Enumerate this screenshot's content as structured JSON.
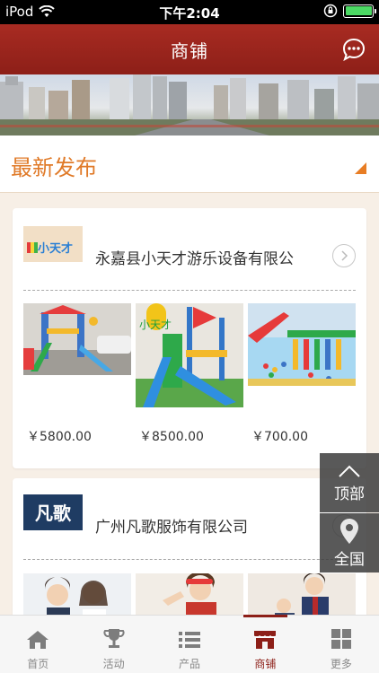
{
  "status": {
    "carrier": "iPod",
    "time": "下午2:04"
  },
  "nav": {
    "title": "商铺"
  },
  "section": {
    "title": "最新发布"
  },
  "stores": [
    {
      "name": "永嘉县小天才游乐设备有限公",
      "logo_text": "小天才",
      "prices": [
        "￥5800.00",
        "￥8500.00",
        "￥700.00"
      ]
    },
    {
      "name": "广州凡歌服饰有限公司",
      "logo_text": "凡歌"
    }
  ],
  "float": {
    "top_label": "顶部",
    "all_label": "全国"
  },
  "tabs": [
    {
      "label": "首页",
      "icon": "home-icon"
    },
    {
      "label": "活动",
      "icon": "trophy-icon"
    },
    {
      "label": "产品",
      "icon": "list-icon"
    },
    {
      "label": "商铺",
      "icon": "shop-icon",
      "active": true
    },
    {
      "label": "更多",
      "icon": "grid-icon"
    }
  ],
  "colors": {
    "brand": "#8d1f18",
    "accent": "#e07a28"
  }
}
